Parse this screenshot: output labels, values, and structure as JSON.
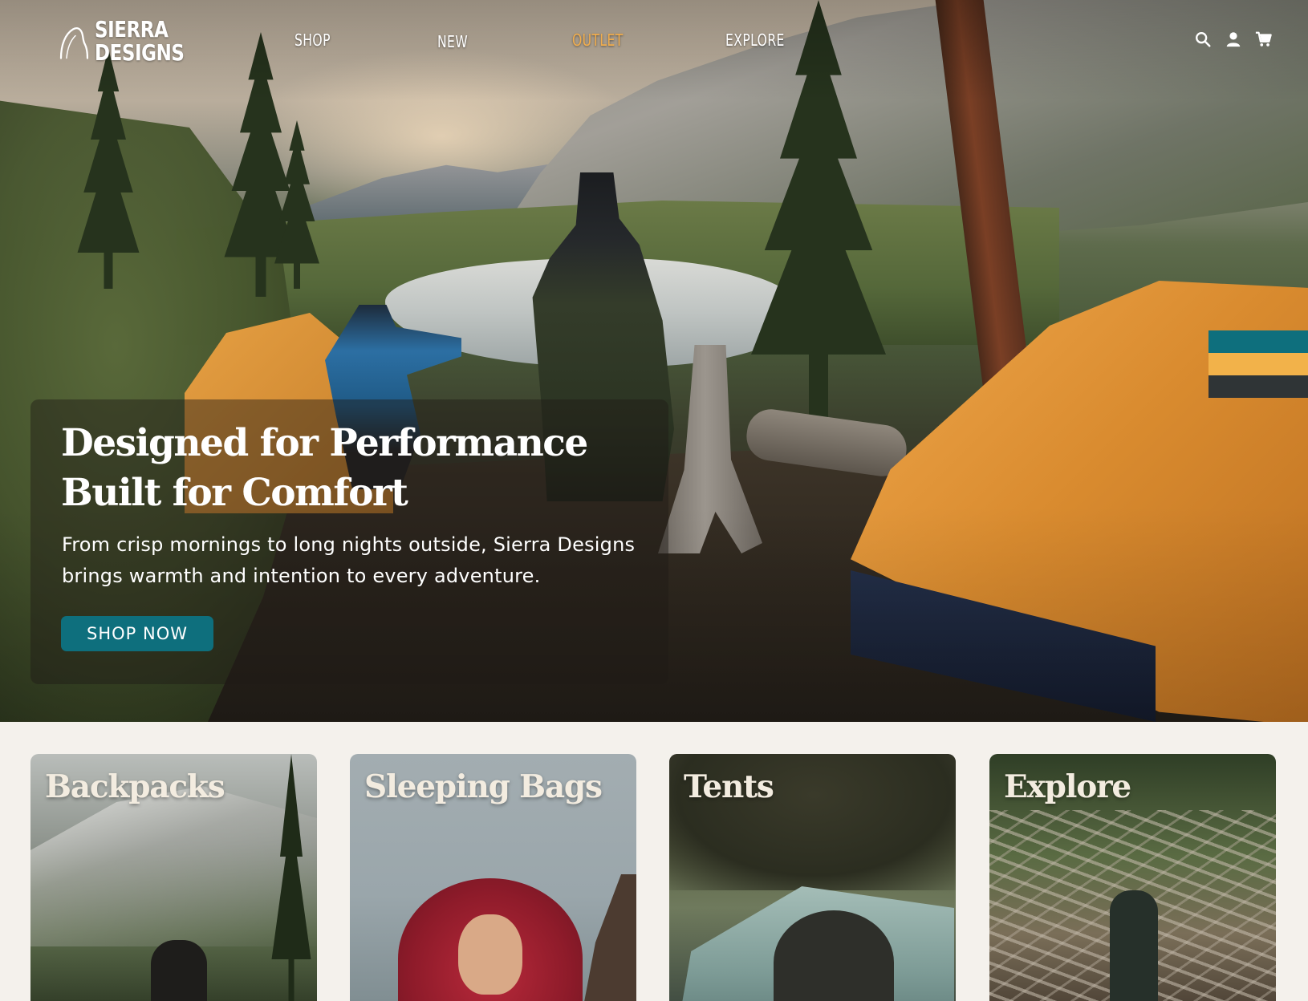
{
  "brand": {
    "name_line1": "SIERRA",
    "name_line2": "DESIGNS"
  },
  "nav": {
    "links": [
      {
        "label": "SHOP"
      },
      {
        "label": "NEW"
      },
      {
        "label": "OUTLET",
        "color": "#f0ad4e"
      },
      {
        "label": "EXPLORE"
      }
    ],
    "icons": [
      "search-icon",
      "user-icon",
      "cart-icon"
    ]
  },
  "hero": {
    "title_line1": "Designed for Performance",
    "title_line2": "Built for Comfort",
    "subtitle_line1": "From crisp mornings to long nights outside, Sierra Designs",
    "subtitle_line2": "brings warmth and intention to every adventure.",
    "cta_label": "SHOP NOW",
    "cta_color": "#0e6f7d",
    "stripe_colors": [
      "#0e6f7d",
      "#f2b24a",
      "#2f3436"
    ]
  },
  "categories": [
    {
      "title": "Backpacks"
    },
    {
      "title": "Sleeping Bags"
    },
    {
      "title": "Tents"
    },
    {
      "title": "Explore"
    }
  ],
  "colors": {
    "background": "#f4f1ec",
    "accent": "#f0ad4e",
    "teal": "#0e6f7d"
  }
}
